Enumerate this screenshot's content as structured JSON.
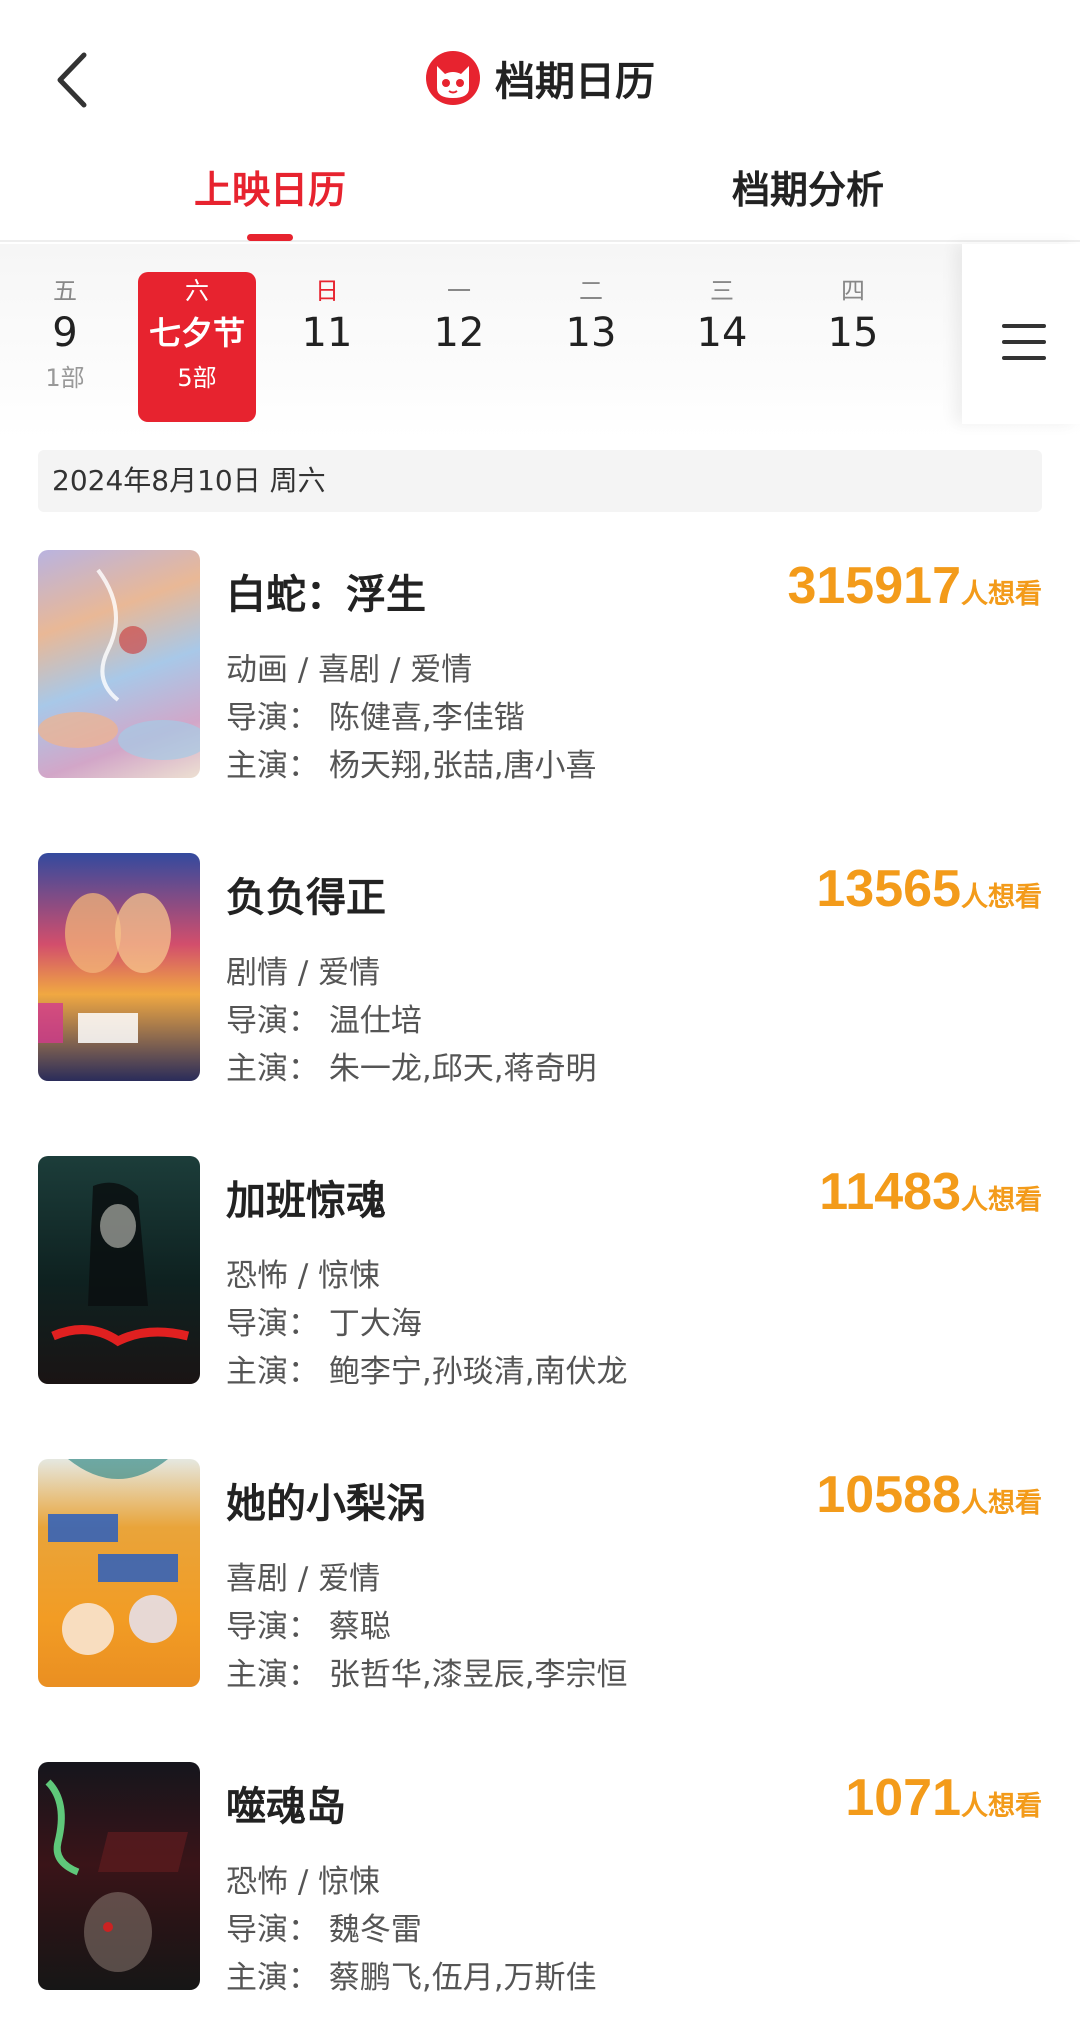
{
  "header": {
    "title": "档期日历"
  },
  "tabs": [
    {
      "label": "上映日历",
      "active": true
    },
    {
      "label": "档期分析",
      "active": false
    }
  ],
  "days": [
    {
      "weekday": "五",
      "date": "9",
      "count": "1部"
    },
    {
      "weekday": "六",
      "date": "七夕节",
      "count": "5部",
      "selected": true
    },
    {
      "weekday": "日",
      "date": "11",
      "count": ""
    },
    {
      "weekday": "一",
      "date": "12",
      "count": ""
    },
    {
      "weekday": "二",
      "date": "13",
      "count": ""
    },
    {
      "weekday": "三",
      "date": "14",
      "count": ""
    },
    {
      "weekday": "四",
      "date": "15",
      "count": ""
    }
  ],
  "date_strip": "2024年8月10日  周六",
  "want_unit": "人想看",
  "movies": [
    {
      "title": "白蛇：浮生",
      "want": "315917",
      "genre": "动画 / 喜剧 / 爱情",
      "director": "导演：  陈健喜,李佳锴",
      "cast": "主演：  杨天翔,张喆,唐小喜"
    },
    {
      "title": "负负得正",
      "want": "13565",
      "genre": "剧情 / 爱情",
      "director": "导演：  温仕培",
      "cast": "主演：  朱一龙,邱天,蒋奇明"
    },
    {
      "title": "加班惊魂",
      "want": "11483",
      "genre": "恐怖 / 惊悚",
      "director": "导演：  丁大海",
      "cast": "主演：  鲍李宁,孙琰清,南伏龙"
    },
    {
      "title": "她的小梨涡",
      "want": "10588",
      "genre": "喜剧 / 爱情",
      "director": "导演：  蔡聪",
      "cast": "主演：  张哲华,漆昱辰,李宗恒"
    },
    {
      "title": "噬魂岛",
      "want": "1071",
      "genre": "恐怖 / 惊悚",
      "director": "导演：  魏冬雷",
      "cast": "主演：  蔡鹏飞,伍月,万斯佳"
    }
  ],
  "colors": {
    "accent": "#e7232f",
    "want": "#f39b1a"
  }
}
